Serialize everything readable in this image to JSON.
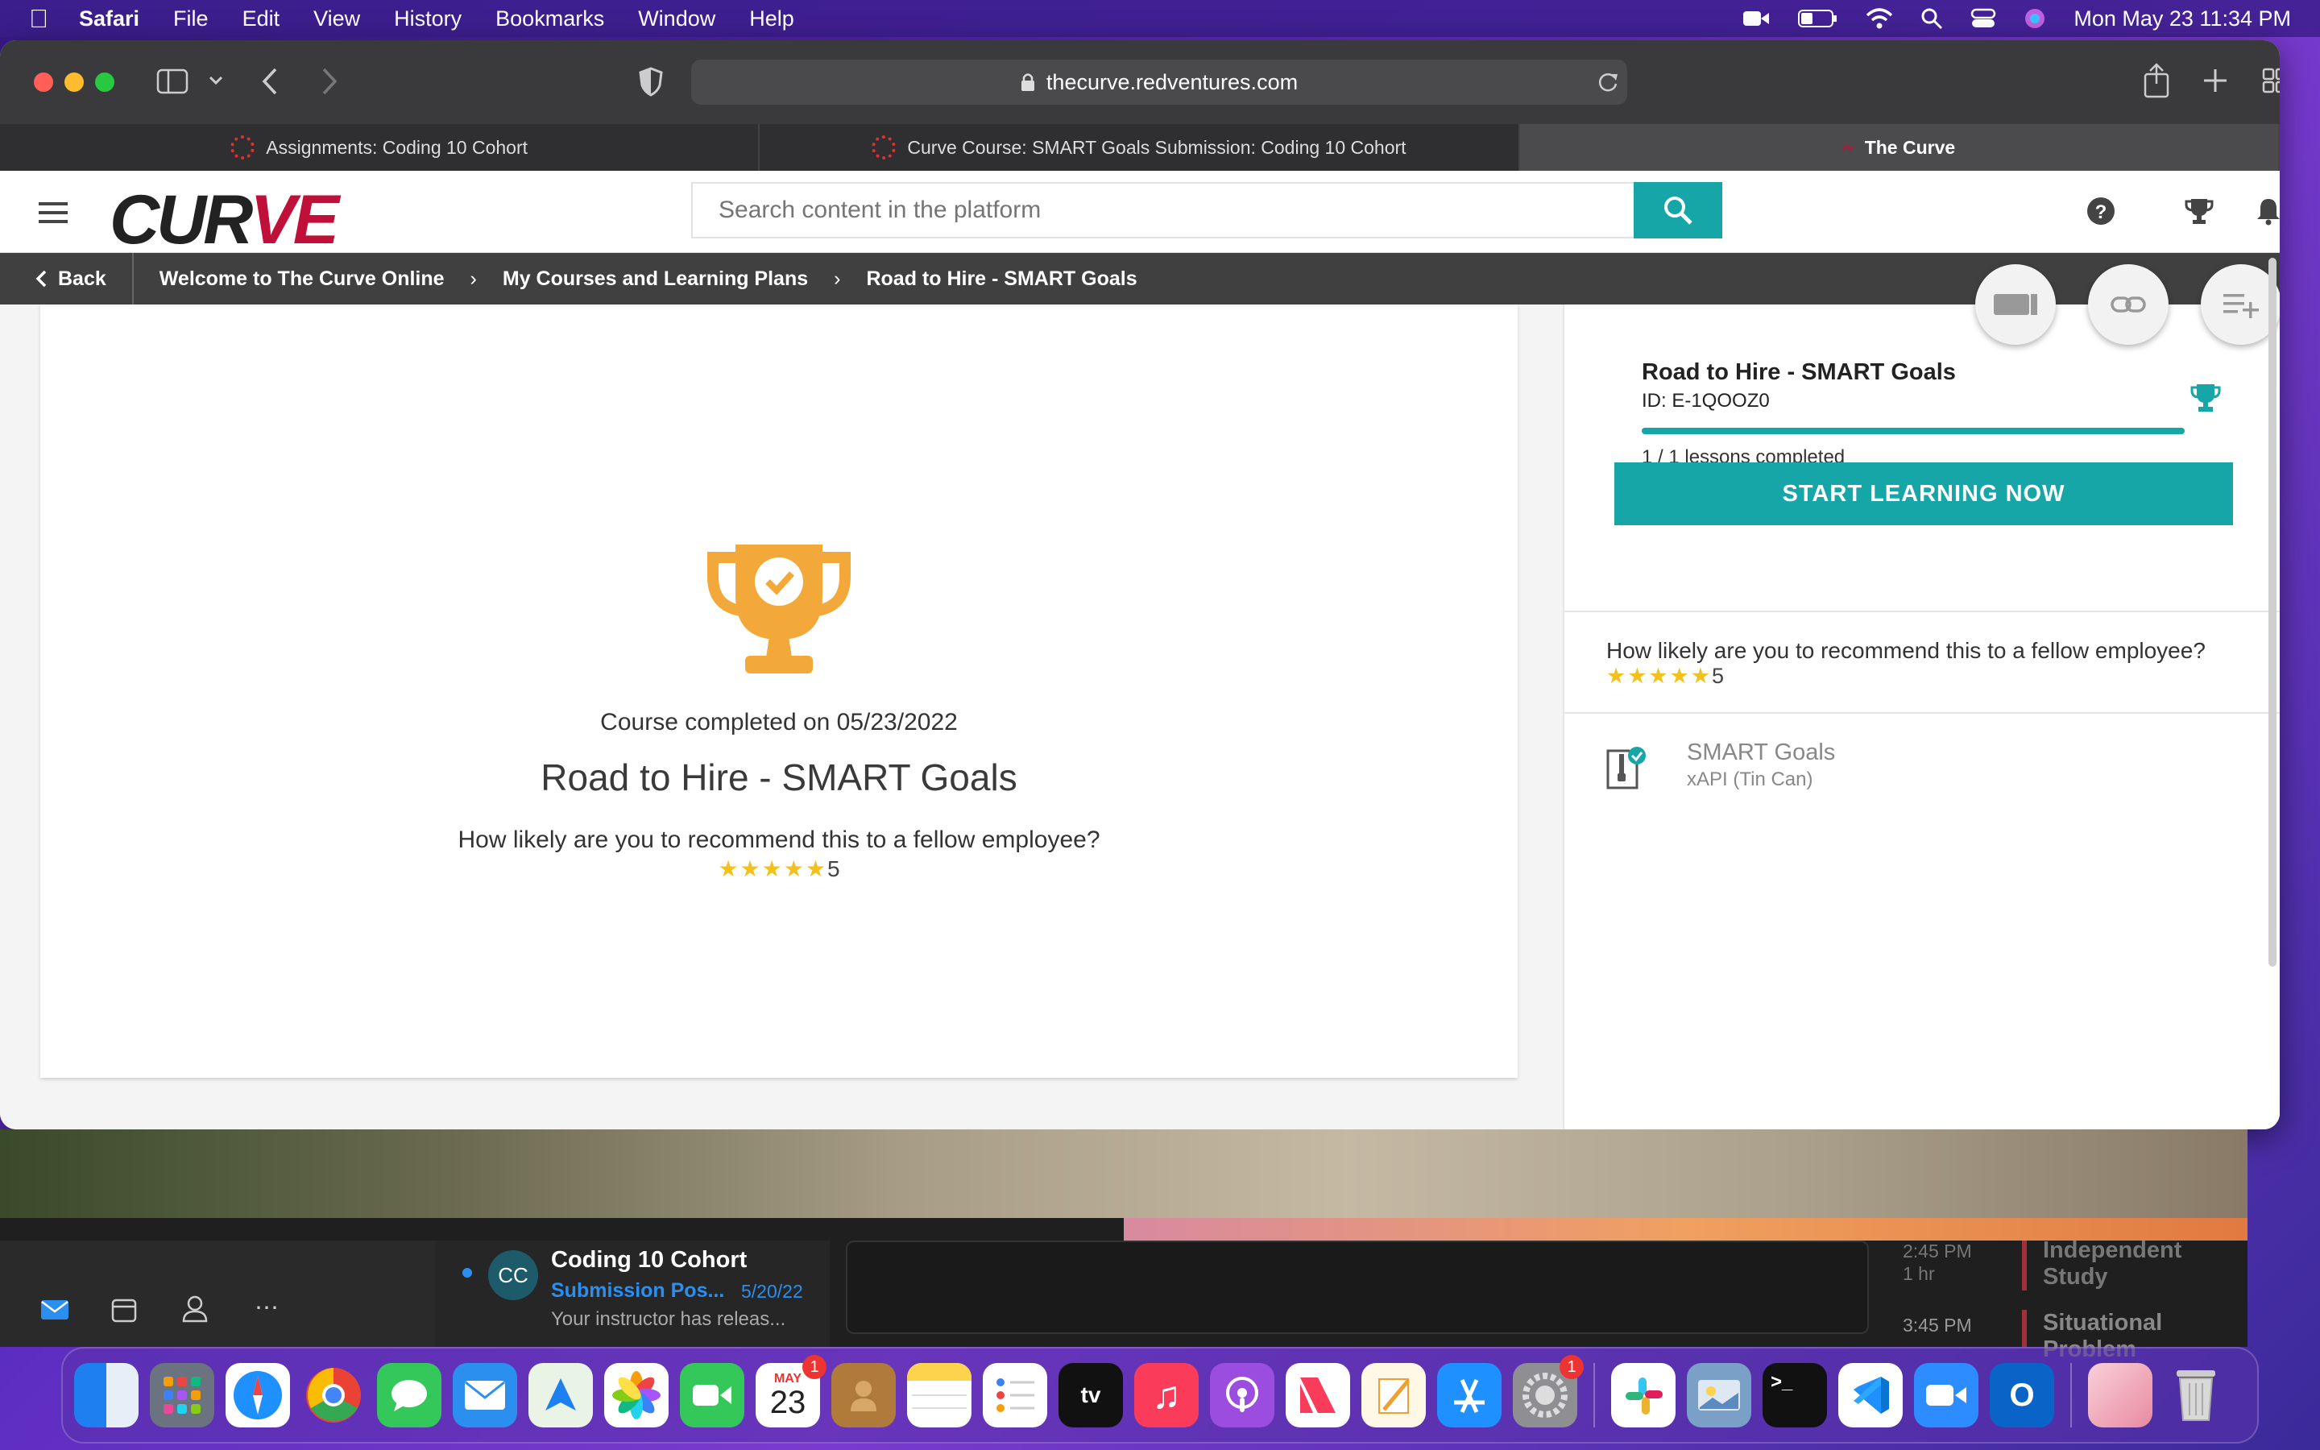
{
  "menubar": {
    "items": [
      "Safari",
      "File",
      "Edit",
      "View",
      "History",
      "Bookmarks",
      "Window",
      "Help"
    ],
    "clock": "Mon May 23  11:34 PM"
  },
  "browser": {
    "url": "thecurve.redventures.com",
    "tabs": [
      {
        "label": "Assignments: Coding 10 Cohort"
      },
      {
        "label": "Curve Course: SMART Goals Submission: Coding 10 Cohort"
      },
      {
        "label": "The Curve"
      }
    ]
  },
  "header": {
    "logo_text": "CUR",
    "logo_accent": "VE",
    "search_placeholder": "Search content in the platform"
  },
  "breadcrumb": {
    "back": "Back",
    "items": [
      "Welcome to The Curve Online",
      "My Courses and Learning Plans",
      "Road to Hire - SMART Goals"
    ]
  },
  "main": {
    "completed_text": "Course completed on 05/23/2022",
    "course_title": "Road to Hire - SMART Goals",
    "recommend_question": "How likely are you to recommend this to a fellow employee?",
    "rating_stars": "★★★★★",
    "rating_value": "5"
  },
  "sidebar": {
    "course_title": "Road to Hire - SMART Goals",
    "course_id": "ID: E-1QOOZ0",
    "progress": 1.0,
    "lessons_completed": "1 / 1 lessons completed",
    "start_button": "START LEARNING NOW",
    "recommend_question": "How likely are you to recommend this to a fellow employee?",
    "rating_stars": "★★★★★",
    "rating_value": "5",
    "lesson": {
      "title": "SMART Goals",
      "type": "xAPI (Tin Can)"
    }
  },
  "outlook": {
    "sender_initials": "CC",
    "sender": "Coding 10 Cohort",
    "subject": "Submission Pos...",
    "date": "5/20/22",
    "preview": "Your instructor has releas...",
    "cal_time1": "2:45 PM",
    "cal_dur1": "1 hr",
    "cal_event1": "Independent Study",
    "cal_time2": "3:45 PM",
    "cal_event2": "Situational Problem"
  },
  "dock": {
    "calendar_month": "MAY",
    "calendar_day": "23",
    "calendar_badge": "1",
    "settings_badge": "1",
    "appletv_label": "tv"
  },
  "colors": {
    "accent": "#17a6a8",
    "star": "#f3c11b",
    "trophy": "#f3a93a",
    "brand_red": "#c0103a"
  }
}
